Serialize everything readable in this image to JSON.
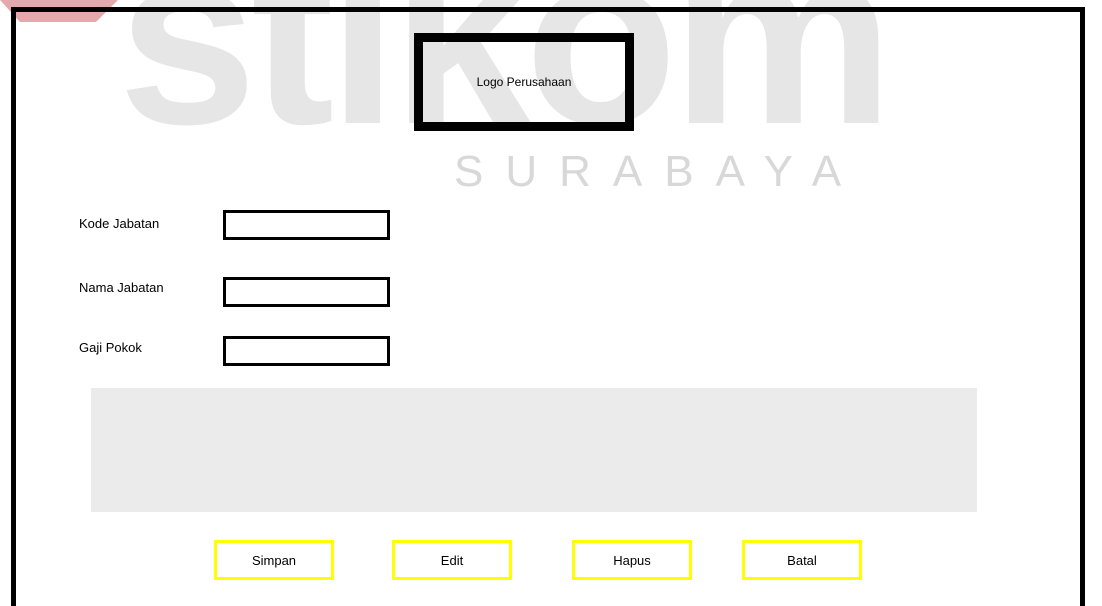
{
  "watermark": {
    "brand": "stikom",
    "city": "SURABAYA"
  },
  "logo": {
    "label": "Logo Perusahaan"
  },
  "form": {
    "fields": [
      {
        "label": "Kode Jabatan",
        "value": ""
      },
      {
        "label": "Nama Jabatan",
        "value": ""
      },
      {
        "label": "Gaji Pokok",
        "value": ""
      }
    ]
  },
  "buttons": {
    "simpan": "Simpan",
    "edit": "Edit",
    "hapus": "Hapus",
    "batal": "Batal"
  },
  "colors": {
    "frame": "#000000",
    "button_border": "#ffff00",
    "grid_background": "#ebebeb",
    "watermark_text": "#e6e6e6",
    "watermark_accent": "#c8102e"
  }
}
